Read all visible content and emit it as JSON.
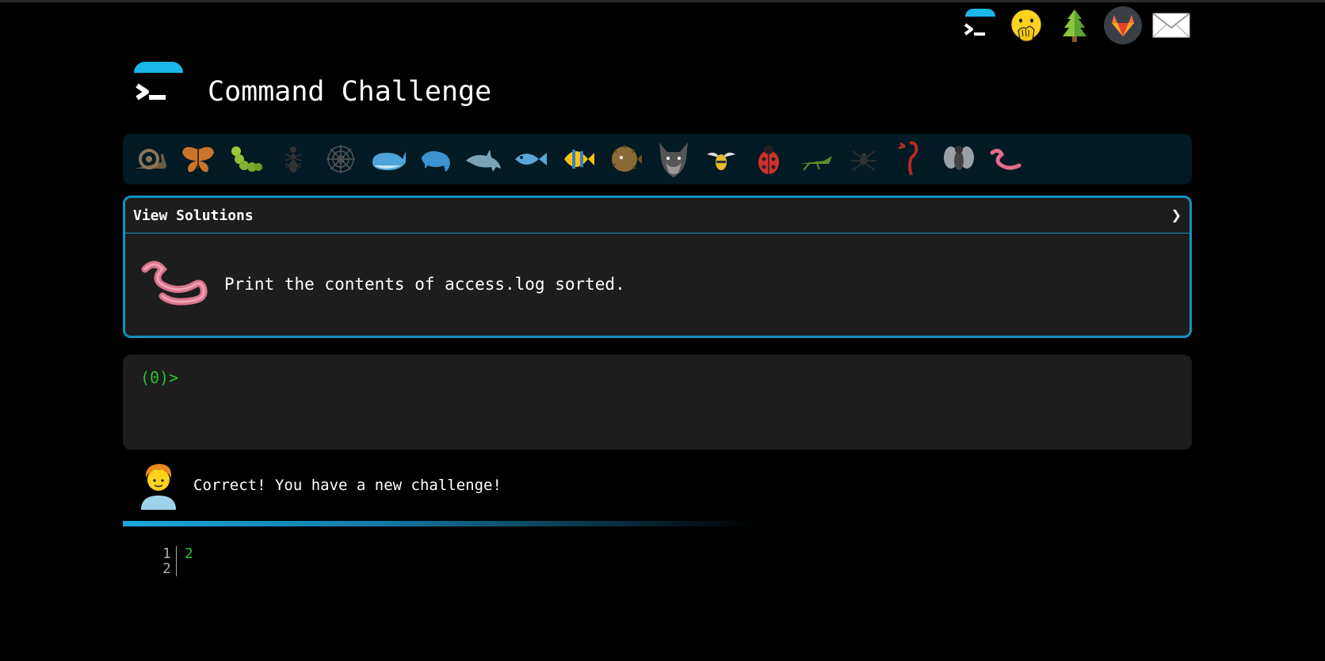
{
  "header": {
    "title": "Command Challenge"
  },
  "top_icons": [
    {
      "name": "terminal-icon"
    },
    {
      "name": "face-with-hand-over-mouth-icon"
    },
    {
      "name": "tree-icon"
    },
    {
      "name": "gitlab-icon"
    },
    {
      "name": "envelope-icon"
    }
  ],
  "critters": [
    "snail",
    "butterfly",
    "caterpillar",
    "ant",
    "spider-web",
    "whale",
    "dolphin-blue",
    "dolphin",
    "fish",
    "tropical-fish",
    "blowfish",
    "wolf",
    "bee",
    "ladybug",
    "cricket",
    "spider",
    "scorpion",
    "fly",
    "worm"
  ],
  "challenge": {
    "view_solutions_label": "View Solutions",
    "chevron": "❯",
    "description": "Print the contents of access.log sorted."
  },
  "terminal": {
    "prompt": "(0)>"
  },
  "feedback": {
    "message": "Correct! You have a new challenge!"
  },
  "output": {
    "line_numbers": [
      "1",
      "2"
    ],
    "lines": [
      "2",
      ""
    ]
  },
  "colors": {
    "accent": "#1ab8e8",
    "prompt_green": "#22c32a",
    "box_border": "#1292c0"
  }
}
